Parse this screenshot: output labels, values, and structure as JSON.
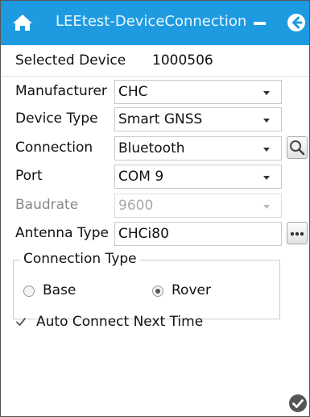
{
  "window": {
    "title": "LEEtest-DeviceConnection"
  },
  "selected_device": {
    "label": "Selected Device",
    "value": "1000506"
  },
  "fields": {
    "manufacturer": {
      "label": "Manufacturer",
      "value": "CHC"
    },
    "device_type": {
      "label": "Device Type",
      "value": "Smart GNSS"
    },
    "connection": {
      "label": "Connection",
      "value": "Bluetooth"
    },
    "port": {
      "label": "Port",
      "value": "COM 9"
    },
    "baudrate": {
      "label": "Baudrate",
      "value": "9600",
      "disabled": true
    },
    "antenna_type": {
      "label": "Antenna Type",
      "value": "CHCi80"
    }
  },
  "connection_type": {
    "legend": "Connection Type",
    "options": [
      {
        "label": "Base",
        "selected": false
      },
      {
        "label": "Rover",
        "selected": true
      }
    ]
  },
  "auto_connect": {
    "label": "Auto Connect Next Time",
    "checked": true
  },
  "colors": {
    "titlebar": "#1e9be0",
    "text": "#111111",
    "disabled_text": "#aaaaaa"
  },
  "icons": {
    "home": "home-icon",
    "minimize": "minimize-icon",
    "back": "back-arrow-icon",
    "search": "search-icon",
    "more": "more-dots-icon",
    "confirm": "check-circle-icon"
  }
}
